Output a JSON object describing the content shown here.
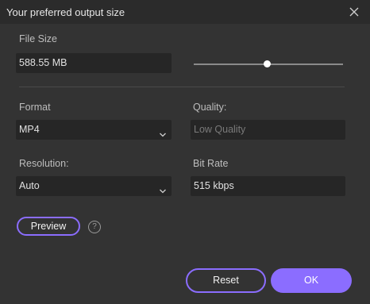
{
  "dialog": {
    "title": "Your preferred output size"
  },
  "file_size": {
    "label": "File Size",
    "value": "588.55 MB",
    "slider_fraction": 0.49
  },
  "format": {
    "label": "Format",
    "value": "MP4"
  },
  "quality": {
    "label": "Quality:",
    "placeholder": "Low Quality"
  },
  "resolution": {
    "label": "Resolution:",
    "value": "Auto"
  },
  "bit_rate": {
    "label": "Bit Rate",
    "value": "515 kbps"
  },
  "preview": {
    "label": "Preview",
    "help_glyph": "?"
  },
  "footer": {
    "reset_label": "Reset",
    "ok_label": "OK"
  },
  "colors": {
    "accent": "#8b6dff",
    "background": "#333333",
    "field": "#262626"
  }
}
